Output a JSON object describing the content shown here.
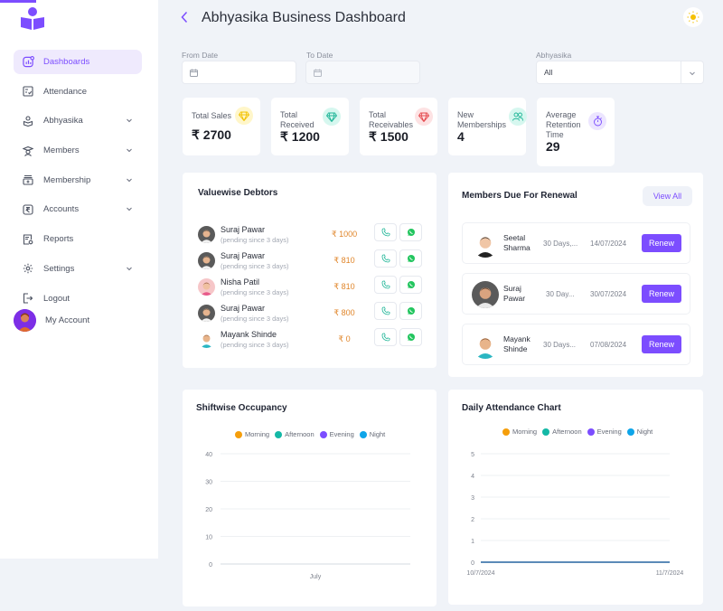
{
  "sidebar": {
    "items": [
      {
        "label": "Dashboards",
        "icon": "dashboard-icon",
        "active": true,
        "expandable": false
      },
      {
        "label": "Attendance",
        "icon": "attendance-icon",
        "active": false,
        "expandable": false
      },
      {
        "label": "Abhyasika",
        "icon": "abhyasika-icon",
        "active": false,
        "expandable": true
      },
      {
        "label": "Members",
        "icon": "members-icon",
        "active": false,
        "expandable": true
      },
      {
        "label": "Membership",
        "icon": "membership-icon",
        "active": false,
        "expandable": true
      },
      {
        "label": "Accounts",
        "icon": "rupee-icon",
        "active": false,
        "expandable": true
      },
      {
        "label": "Reports",
        "icon": "reports-icon",
        "active": false,
        "expandable": false
      },
      {
        "label": "Settings",
        "icon": "gear-icon",
        "active": false,
        "expandable": true
      },
      {
        "label": "Logout",
        "icon": "logout-icon",
        "active": false,
        "expandable": false
      }
    ],
    "account_label": "My Account"
  },
  "header": {
    "title": "Abhyasika Business Dashboard"
  },
  "filters": {
    "from_date": {
      "label": "From Date",
      "value": ""
    },
    "to_date": {
      "label": "To Date",
      "value": ""
    },
    "abhyasika": {
      "label": "Abhyasika",
      "value": "All"
    }
  },
  "stats": [
    {
      "label": "Total Sales",
      "value": "₹ 2700",
      "icon": "diamond-icon",
      "color": "#f2c200",
      "bg": "#fff6c9"
    },
    {
      "label": "Total Received",
      "value": "₹ 1200",
      "icon": "diamond-icon",
      "color": "#1fb597",
      "bg": "#d6f7ef"
    },
    {
      "label": "Total Receivables",
      "value": "₹ 1500",
      "icon": "diamond-icon",
      "color": "#e5484d",
      "bg": "#fde2e3"
    },
    {
      "label": "New Memberships",
      "value": "4",
      "icon": "users-icon",
      "color": "#1fb597",
      "bg": "#d6f7ef"
    },
    {
      "label": "Average Retention Time",
      "value": "29",
      "icon": "stopwatch-icon",
      "color": "#7c4dff",
      "bg": "#ece5ff"
    }
  ],
  "debtors": {
    "title": "Valuewise Debtors",
    "rows": [
      {
        "name": "Suraj Pawar",
        "note": "(pending since 3 days)",
        "amount": "₹ 1000"
      },
      {
        "name": "Suraj Pawar",
        "note": "(pending since 3 days)",
        "amount": "₹ 810"
      },
      {
        "name": "Nisha Patil",
        "note": "(pending since 3 days)",
        "amount": "₹ 810"
      },
      {
        "name": "Suraj Pawar",
        "note": "(pending since 3 days)",
        "amount": "₹ 800"
      },
      {
        "name": "Mayank Shinde",
        "note": "(pending since 3 days)",
        "amount": "₹ 0"
      }
    ]
  },
  "renewals": {
    "title": "Members Due For Renewal",
    "view_all": "View All",
    "renew_label": "Renew",
    "rows": [
      {
        "first": "Seetal",
        "last": "Sharma",
        "duration": "30 Days,...",
        "date": "14/07/2024"
      },
      {
        "first": "Suraj",
        "last": "Pawar",
        "duration": "30 Day...",
        "date": "30/07/2024"
      },
      {
        "first": "Mayank",
        "last": "Shinde",
        "duration": "30 Days...",
        "date": "07/08/2024"
      }
    ]
  },
  "chart_data": [
    {
      "type": "bar",
      "title": "Shiftwise Occupancy",
      "categories": [
        "July"
      ],
      "series": [
        {
          "name": "Morning",
          "color": "#f59e0b",
          "values": [
            0
          ]
        },
        {
          "name": "Afternoon",
          "color": "#14b8a6",
          "values": [
            0
          ]
        },
        {
          "name": "Evening",
          "color": "#7c4dff",
          "values": [
            0
          ]
        },
        {
          "name": "Night",
          "color": "#0ea5e9",
          "values": [
            0
          ]
        }
      ],
      "yticks": [
        0,
        10,
        20,
        30,
        40
      ],
      "ylim": [
        0,
        40
      ],
      "xlabel": "",
      "ylabel": "",
      "grid": true,
      "legend": "top-center"
    },
    {
      "type": "line",
      "title": "Daily Attendance Chart",
      "x": [
        "10/7/2024",
        "11/7/2024"
      ],
      "series": [
        {
          "name": "Morning",
          "color": "#f59e0b",
          "values": [
            0,
            0
          ]
        },
        {
          "name": "Afternoon",
          "color": "#14b8a6",
          "values": [
            0,
            0
          ]
        },
        {
          "name": "Evening",
          "color": "#7c4dff",
          "values": [
            0,
            0
          ]
        },
        {
          "name": "Night",
          "color": "#0ea5e9",
          "values": [
            0,
            0
          ]
        }
      ],
      "yticks": [
        0,
        1,
        2,
        3,
        4,
        5
      ],
      "ylim": [
        0,
        5
      ],
      "xlabel": "",
      "ylabel": "",
      "grid": true,
      "legend": "top-center"
    }
  ]
}
